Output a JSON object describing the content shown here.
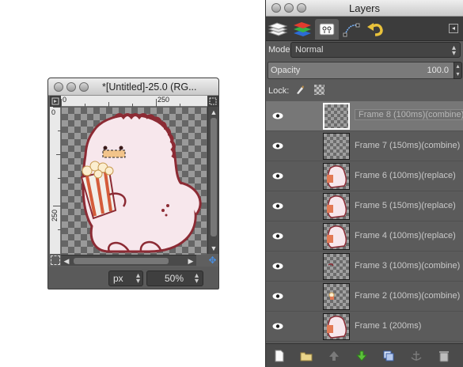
{
  "canvas_window": {
    "title": "*[Untitled]-25.0 (RG...",
    "ruler_top_ticks": [
      "0",
      "250"
    ],
    "ruler_left_ticks": [
      "0",
      "250"
    ],
    "unit": "px",
    "zoom": "50%"
  },
  "layers_window": {
    "title": "Layers",
    "tabs": [
      "layers-tab",
      "channels-tab",
      "paths-tab",
      "tool-options-tab",
      "undo-history-tab"
    ],
    "mode_label": "Mode:",
    "mode_value": "Normal",
    "opacity_label": "Opacity",
    "opacity_value": "100.0",
    "lock_label": "Lock:",
    "layers": [
      {
        "name": "Frame 8  (100ms)(combine)",
        "selected": true
      },
      {
        "name": "Frame 7  (150ms)(combine)",
        "selected": false
      },
      {
        "name": "Frame 6  (100ms)(replace)",
        "selected": false
      },
      {
        "name": "Frame 5  (150ms)(replace)",
        "selected": false
      },
      {
        "name": "Frame 4  (100ms)(replace)",
        "selected": false
      },
      {
        "name": "Frame 3  (100ms)(combine)",
        "selected": false
      },
      {
        "name": "Frame 2  (100ms)(combine)",
        "selected": false
      },
      {
        "name": "Frame 1  (200ms)",
        "selected": false
      }
    ],
    "bottom_buttons": [
      "new-layer",
      "new-layer-group",
      "raise-layer",
      "lower-layer",
      "duplicate-layer",
      "anchor-layer",
      "delete-layer"
    ]
  }
}
